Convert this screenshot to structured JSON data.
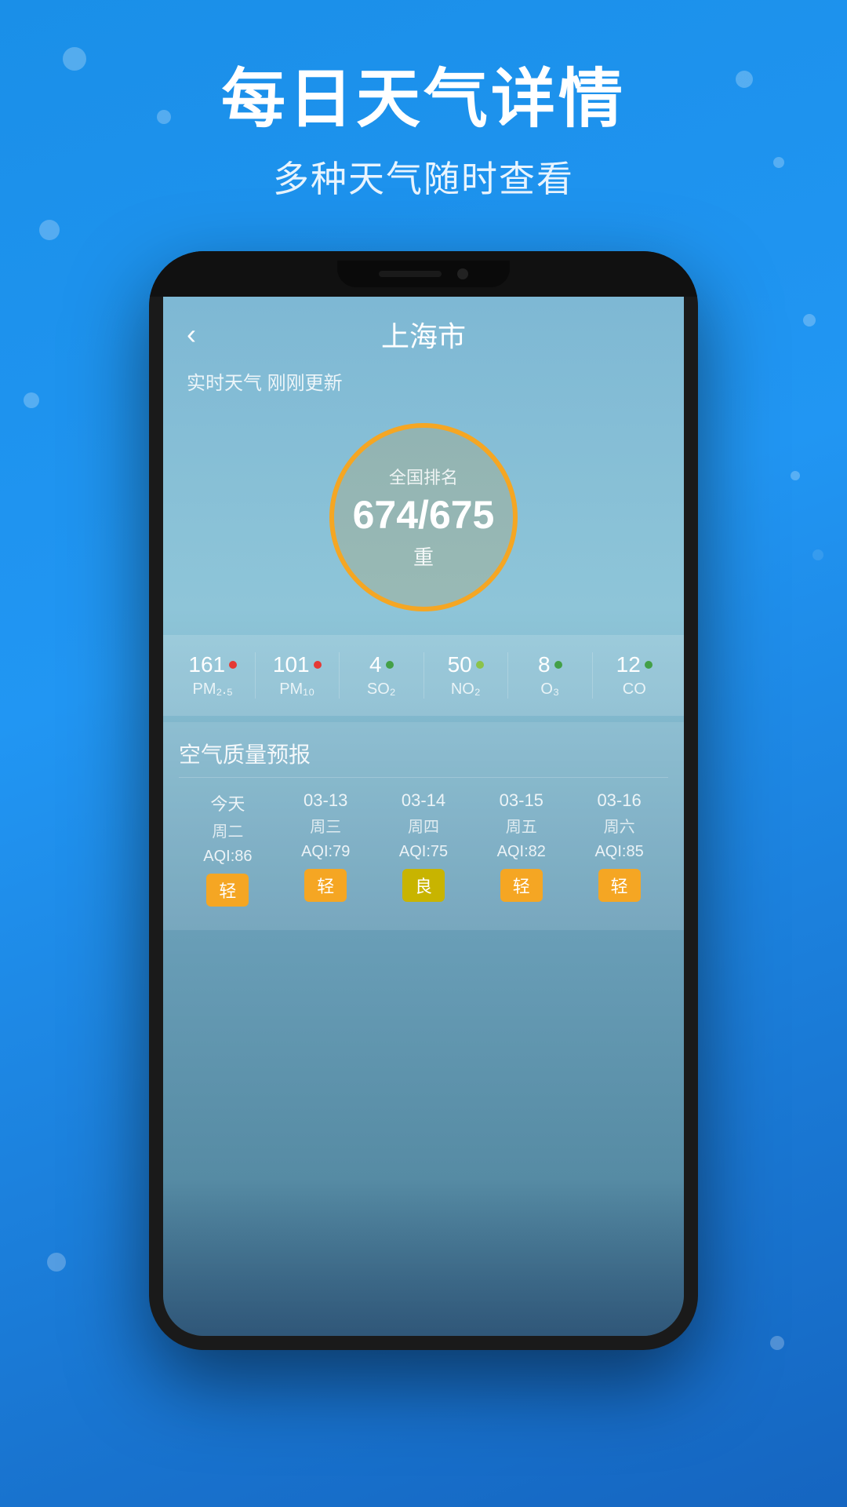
{
  "background": {
    "color1": "#1a8fe8",
    "color2": "#2196F3"
  },
  "header": {
    "main_title": "每日天气详情",
    "sub_title": "多种天气随时查看"
  },
  "app_screen": {
    "back_label": "‹",
    "city": "上海市",
    "update_text": "实时天气 刚刚更新",
    "aqi_circle": {
      "label_top": "全国排名",
      "value": "674/675",
      "level": "重"
    },
    "pollutants": [
      {
        "value": "161",
        "dot_class": "dot-red",
        "name": "PM₂.₅"
      },
      {
        "value": "101",
        "dot_class": "dot-red",
        "name": "PM₁₀"
      },
      {
        "value": "4",
        "dot_class": "dot-green",
        "name": "SO₂"
      },
      {
        "value": "50",
        "dot_class": "dot-yellow-green",
        "name": "NO₂"
      },
      {
        "value": "8",
        "dot_class": "dot-green",
        "name": "O₃"
      },
      {
        "value": "12",
        "dot_class": "dot-green",
        "name": "CO"
      }
    ],
    "forecast_section_title": "空气质量预报",
    "forecast": [
      {
        "day": "今天",
        "weekday": "周二",
        "aqi": "AQI:86",
        "badge": "轻",
        "badge_class": "badge-orange"
      },
      {
        "day": "03-13",
        "weekday": "周三",
        "aqi": "AQI:79",
        "badge": "轻",
        "badge_class": "badge-orange"
      },
      {
        "day": "03-14",
        "weekday": "周四",
        "aqi": "AQI:75",
        "badge": "良",
        "badge_class": "badge-yellow"
      },
      {
        "day": "03-15",
        "weekday": "周五",
        "aqi": "AQI:82",
        "badge": "轻",
        "badge_class": "badge-orange"
      },
      {
        "day": "03-16",
        "weekday": "周六",
        "aqi": "AQI:85",
        "badge": "轻",
        "badge_class": "badge-orange"
      }
    ]
  }
}
